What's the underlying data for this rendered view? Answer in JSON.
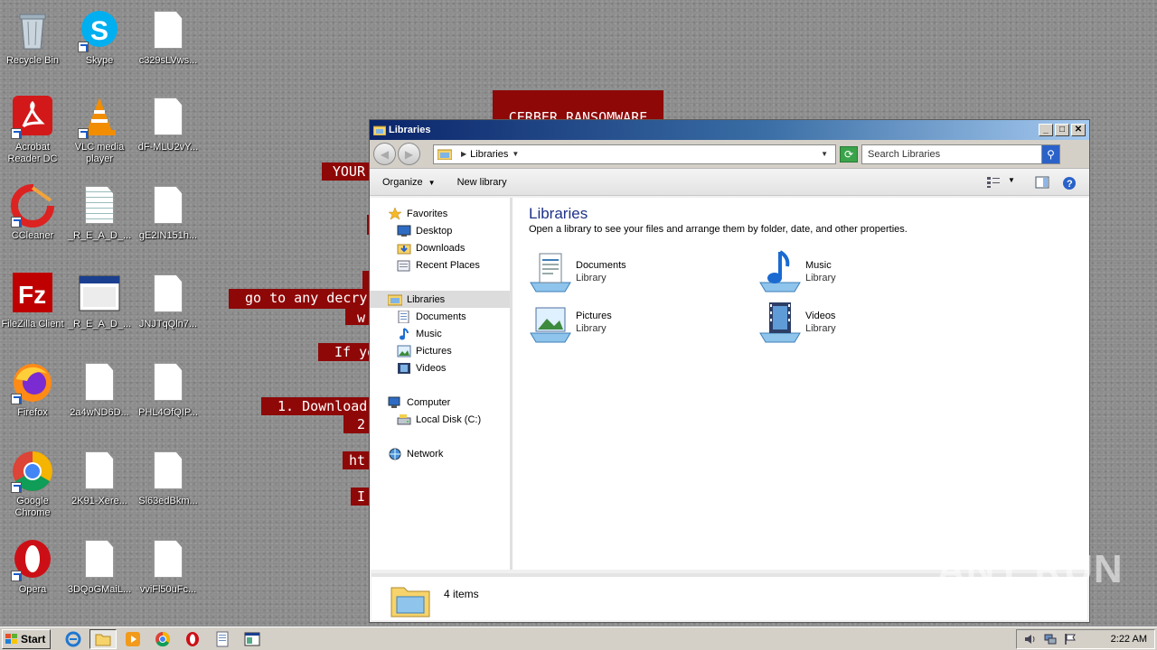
{
  "desktop": {
    "icons": [
      {
        "label": "Recycle Bin"
      },
      {
        "label": "Skype"
      },
      {
        "label": "c329sLVws..."
      },
      {
        "label": "Acrobat Reader DC"
      },
      {
        "label": "VLC media player"
      },
      {
        "label": "dF-MLU2vY..."
      },
      {
        "label": "CCleaner"
      },
      {
        "label": "_R_E_A_D_..."
      },
      {
        "label": "gE2IN151h..."
      },
      {
        "label": "FileZilla Client"
      },
      {
        "label": "_R_E_A_D_..."
      },
      {
        "label": "JNJTqQln7..."
      },
      {
        "label": "Firefox"
      },
      {
        "label": "2a4wND6D..."
      },
      {
        "label": "PHL4OfQIP..."
      },
      {
        "label": "Google Chrome"
      },
      {
        "label": "2K91-Xere..."
      },
      {
        "label": "Sl63edBkm..."
      },
      {
        "label": "Opera"
      },
      {
        "label": "3DQoGMaiL..."
      },
      {
        "label": "vviFl50uFc..."
      }
    ],
    "ransom_lines": [
      "CERBER RANSOMWARE",
      "YOUR",
      "go to any decry",
      "w",
      "If yo",
      "1. Download",
      "2",
      "ht",
      "I"
    ],
    "watermark": "ANY RUN"
  },
  "window": {
    "title": "Libraries",
    "address": {
      "crumb": "Libraries"
    },
    "search_placeholder": "Search Libraries",
    "toolbar": {
      "organize": "Organize",
      "new_library": "New library"
    },
    "nav": {
      "favorites": "Favorites",
      "desktop": "Desktop",
      "downloads": "Downloads",
      "recent_places": "Recent Places",
      "libraries": "Libraries",
      "documents": "Documents",
      "music": "Music",
      "pictures": "Pictures",
      "videos": "Videos",
      "computer": "Computer",
      "local_disk": "Local Disk (C:)",
      "network": "Network"
    },
    "content": {
      "heading": "Libraries",
      "subtitle": "Open a library to see your files and arrange them by folder, date, and other properties.",
      "libraries": [
        {
          "name": "Documents",
          "type": "Library"
        },
        {
          "name": "Music",
          "type": "Library"
        },
        {
          "name": "Pictures",
          "type": "Library"
        },
        {
          "name": "Videos",
          "type": "Library"
        }
      ]
    },
    "status": {
      "count": "4 items"
    }
  },
  "taskbar": {
    "start_label": "Start",
    "clock": "2:22 AM"
  },
  "colors": {
    "ransom_bg": "#8e0808",
    "title_gradient_start": "#0a246a",
    "heading_blue": "#1e3287"
  }
}
